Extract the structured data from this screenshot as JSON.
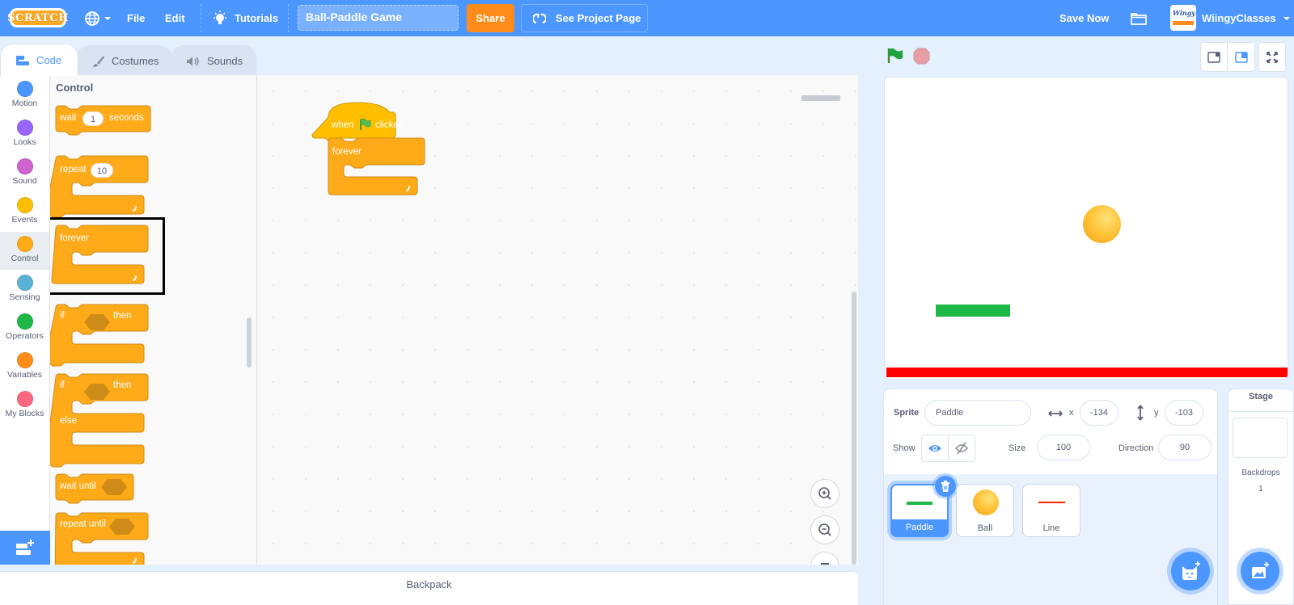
{
  "menubar": {
    "logo": "SCRATCH",
    "file_label": "File",
    "edit_label": "Edit",
    "tutorials_label": "Tutorials",
    "project_title": "Ball-Paddle Game",
    "share_label": "Share",
    "see_project_page_label": "See Project Page",
    "save_now_label": "Save Now",
    "username": "WiingyClasses",
    "avatar_text": "Wingy"
  },
  "tabs": [
    {
      "label": "Code",
      "icon": "code-icon",
      "active": true
    },
    {
      "label": "Costumes",
      "icon": "brush-icon",
      "active": false
    },
    {
      "label": "Sounds",
      "icon": "speaker-icon",
      "active": false
    }
  ],
  "categories": [
    {
      "label": "Motion",
      "color": "#4c97ff"
    },
    {
      "label": "Looks",
      "color": "#9966ff"
    },
    {
      "label": "Sound",
      "color": "#cf63cf"
    },
    {
      "label": "Events",
      "color": "#ffbf00"
    },
    {
      "label": "Control",
      "color": "#ffab19",
      "active": true
    },
    {
      "label": "Sensing",
      "color": "#5cb1d6"
    },
    {
      "label": "Operators",
      "color": "#59c059"
    },
    {
      "label": "Variables",
      "color": "#ff8c1a"
    },
    {
      "label": "My Blocks",
      "color": "#ff6680"
    }
  ],
  "palette": {
    "title": "Control",
    "blocks": {
      "wait": {
        "label": "wait",
        "value": "1",
        "suffix": "seconds"
      },
      "repeat": {
        "label": "repeat",
        "value": "10"
      },
      "forever": {
        "label": "forever",
        "highlighted": true
      },
      "if_then": {
        "label": "if",
        "suffix": "then"
      },
      "if_else": {
        "label": "if",
        "suffix": "then",
        "else_label": "else"
      },
      "wait_until": {
        "label": "wait until"
      },
      "repeat_until": {
        "label": "repeat until"
      }
    }
  },
  "scripts": {
    "hat": {
      "prefix": "when",
      "suffix": "clicked",
      "icon": "green-flag-icon"
    },
    "forever": {
      "label": "forever"
    }
  },
  "backpack_label": "Backpack",
  "sprite_info": {
    "sprite_label": "Sprite",
    "sprite_name": "Paddle",
    "x_label": "x",
    "x_value": "-134",
    "y_label": "y",
    "y_value": "-103",
    "show_label": "Show",
    "size_label": "Size",
    "size_value": "100",
    "direction_label": "Direction",
    "direction_value": "90"
  },
  "sprites": [
    {
      "name": "Paddle",
      "selected": true,
      "thumb_color": "#1db845"
    },
    {
      "name": "Ball",
      "selected": false,
      "thumb_color": "#ffb300"
    },
    {
      "name": "Line",
      "selected": false,
      "thumb_color": "#ff2200"
    }
  ],
  "stage_pane": {
    "title": "Stage",
    "backdrops_label": "Backdrops",
    "backdrops_count": "1"
  },
  "colors": {
    "accent": "#4c97ff",
    "control": "#ffab19",
    "share": "#ff8c1a",
    "paddle": "#1db845",
    "line": "#ff0000"
  }
}
